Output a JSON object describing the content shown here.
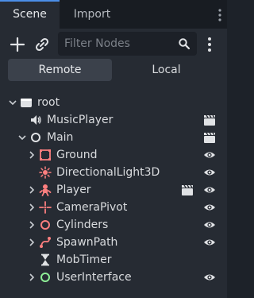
{
  "tabs": {
    "scene": "Scene",
    "import": "Import"
  },
  "toolbar": {
    "add_icon": "plus-icon",
    "link_icon": "link-icon",
    "filter_placeholder": "Filter Nodes",
    "search_icon": "search-icon",
    "menu_icon": "kebab-menu-icon"
  },
  "mode": {
    "remote": "Remote",
    "local": "Local",
    "selected": "Remote"
  },
  "tree": [
    {
      "label": "root",
      "icon": "folder-node-icon",
      "expanded": true,
      "depth": 0,
      "right_icons": []
    },
    {
      "label": "MusicPlayer",
      "icon": "audio-stream-player-icon",
      "depth": 1,
      "right_icons": [
        "clapperboard-icon"
      ]
    },
    {
      "label": "Main",
      "icon": "node3d-icon",
      "expanded": true,
      "depth": 1,
      "right_icons": [
        "clapperboard-icon"
      ]
    },
    {
      "label": "Ground",
      "icon": "static-body-icon",
      "collapsed": true,
      "depth": 2,
      "right_icons": [
        "visibility-eye-icon"
      ]
    },
    {
      "label": "DirectionalLight3D",
      "icon": "directional-light-icon",
      "depth": 2,
      "right_icons": [
        "visibility-eye-icon"
      ]
    },
    {
      "label": "Player",
      "icon": "character-body-icon",
      "collapsed": true,
      "depth": 2,
      "right_icons": [
        "clapperboard-icon",
        "visibility-eye-icon"
      ]
    },
    {
      "label": "CameraPivot",
      "icon": "marker3d-icon",
      "collapsed": true,
      "depth": 2,
      "right_icons": [
        "visibility-eye-icon"
      ]
    },
    {
      "label": "Cylinders",
      "icon": "node3d-icon",
      "collapsed": true,
      "depth": 2,
      "right_icons": [
        "visibility-eye-icon"
      ]
    },
    {
      "label": "SpawnPath",
      "icon": "path3d-icon",
      "collapsed": true,
      "depth": 2,
      "right_icons": [
        "visibility-eye-icon"
      ]
    },
    {
      "label": "MobTimer",
      "icon": "timer-icon",
      "depth": 2,
      "right_icons": []
    },
    {
      "label": "UserInterface",
      "icon": "control-node-icon",
      "collapsed": true,
      "depth": 2,
      "right_icons": [
        "visibility-eye-icon"
      ]
    }
  ],
  "colors": {
    "accent": "#4b8ee8",
    "node3d": "#fc7f7f",
    "control": "#8eef97",
    "text": "#d9dbde",
    "panel_bg": "#262b33"
  }
}
